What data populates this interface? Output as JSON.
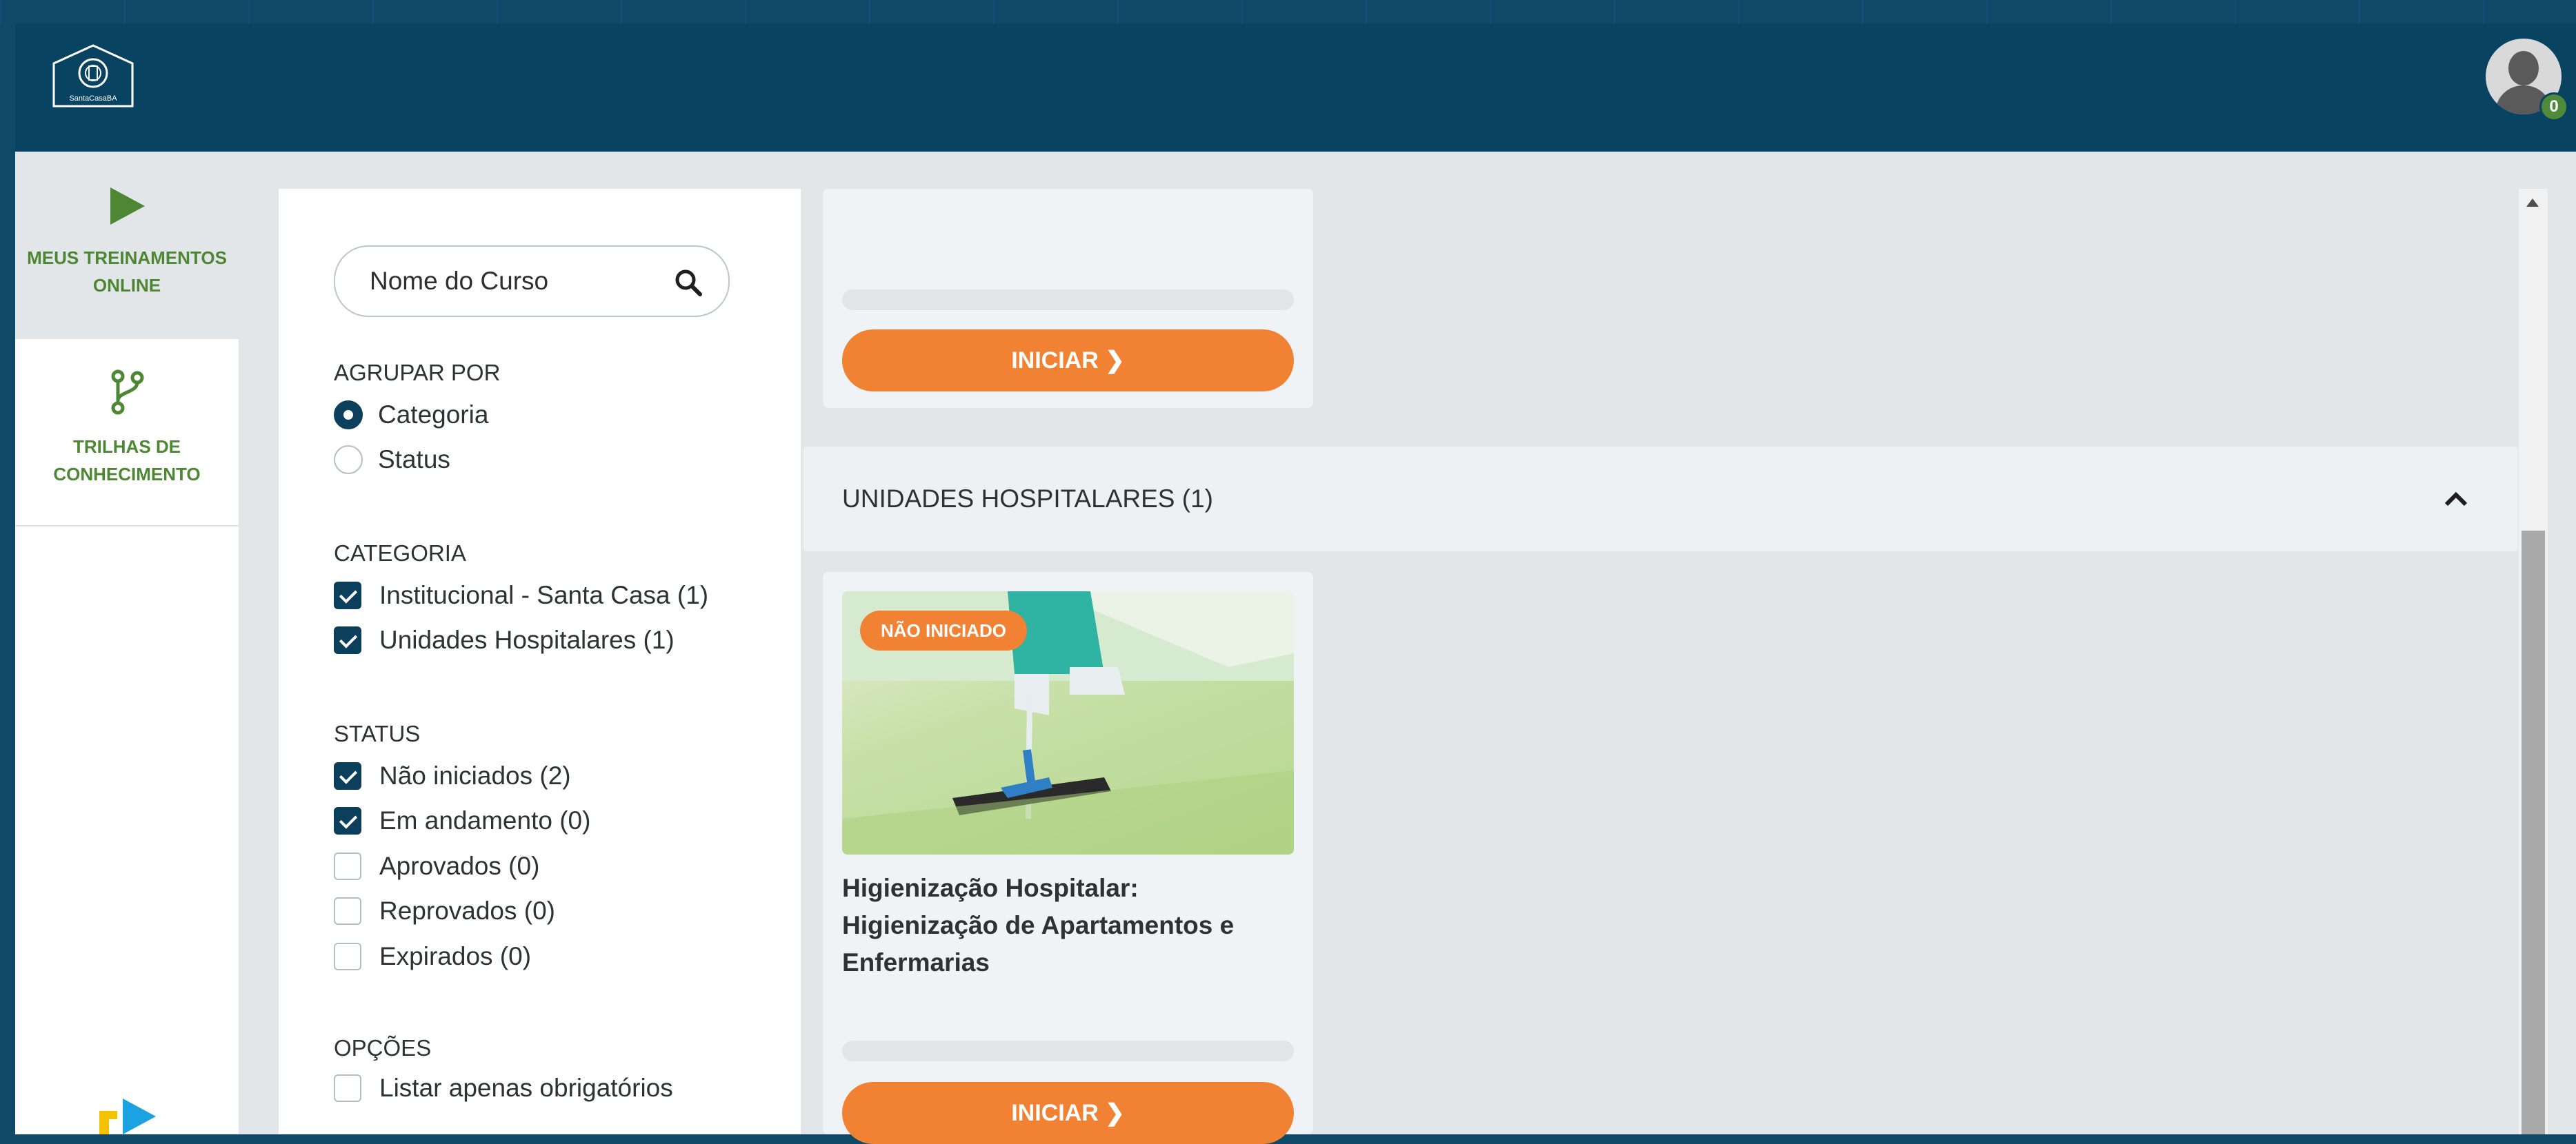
{
  "header": {
    "logo_text": "SantaCasaBA",
    "notification_count": "0"
  },
  "nav": {
    "items": [
      {
        "label_line1": "MEUS TREINAMENTOS",
        "label_line2": "ONLINE",
        "icon": "play-icon"
      },
      {
        "label_line1": "TRILHAS DE",
        "label_line2": "CONHECIMENTO",
        "icon": "branch-icon"
      }
    ]
  },
  "filters": {
    "search_placeholder": "Nome do Curso",
    "group_by_title": "AGRUPAR POR",
    "group_by_options": [
      {
        "label": "Categoria",
        "selected": true
      },
      {
        "label": "Status",
        "selected": false
      }
    ],
    "category_title": "CATEGORIA",
    "categories": [
      {
        "label": "Institucional - Santa Casa (1)",
        "checked": true
      },
      {
        "label": "Unidades Hospitalares (1)",
        "checked": true
      }
    ],
    "status_title": "STATUS",
    "statuses": [
      {
        "label": "Não iniciados (2)",
        "checked": true
      },
      {
        "label": "Em andamento (0)",
        "checked": true
      },
      {
        "label": "Aprovados (0)",
        "checked": false
      },
      {
        "label": "Reprovados (0)",
        "checked": false
      },
      {
        "label": "Expirados (0)",
        "checked": false
      }
    ],
    "options_title": "OPÇÕES",
    "options": [
      {
        "label": "Listar apenas obrigatórios",
        "checked": false
      }
    ]
  },
  "content": {
    "start_label": "INICIAR",
    "group_title": "UNIDADES HOSPITALARES (1)",
    "course": {
      "status": "NÃO INICIADO",
      "title": "Higienização Hospitalar: Higienização de Apartamentos e Enfermarias"
    }
  },
  "colors": {
    "header": "#084462",
    "accent": "#f28233",
    "nav_green": "#4e8734",
    "checkbox": "#0b3f5c"
  }
}
